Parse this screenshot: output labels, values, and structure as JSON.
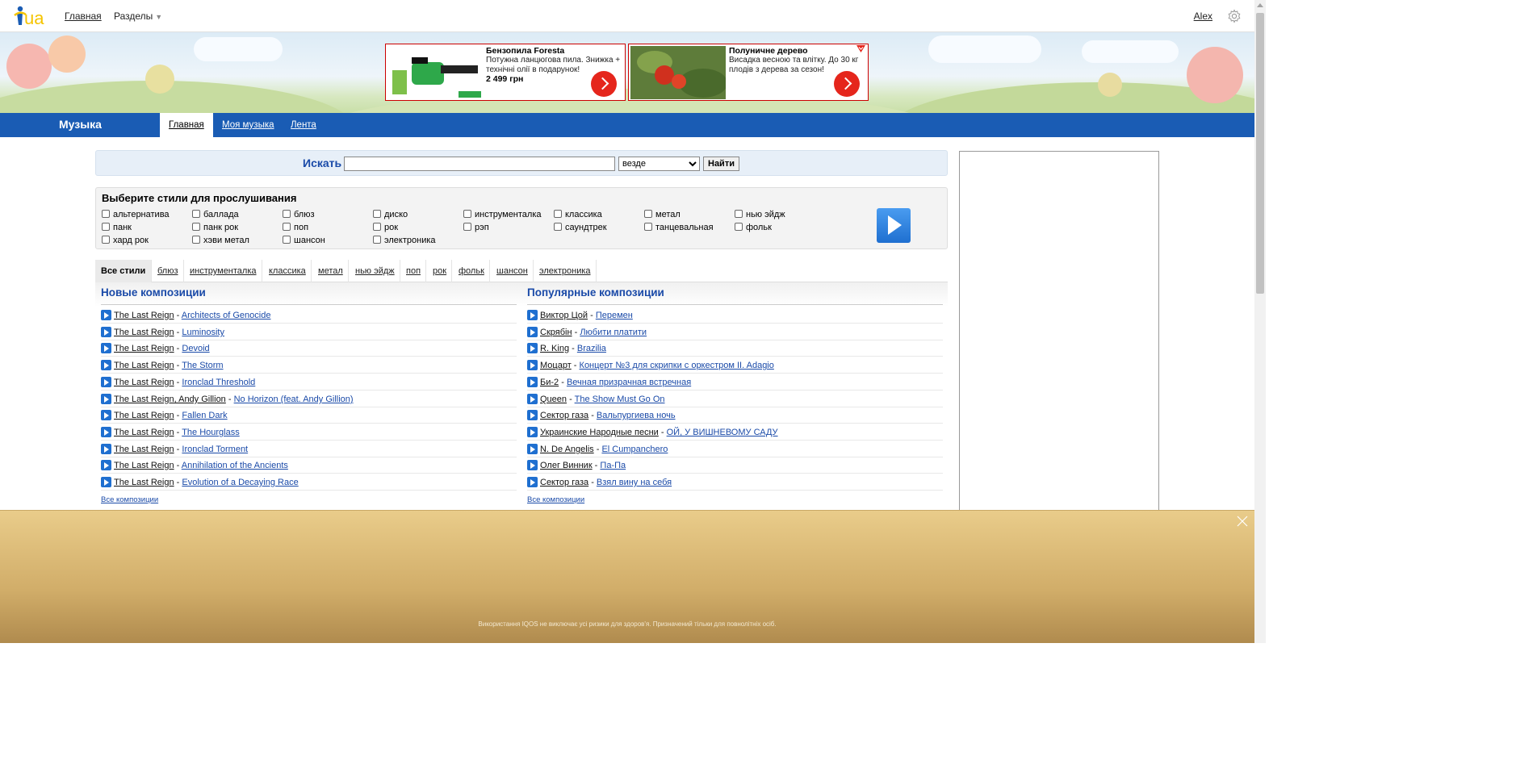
{
  "topbar": {
    "logo": "i.ua",
    "home_link": "Главная",
    "sections_menu": "Разделы",
    "user_name": "Alex"
  },
  "ads": [
    {
      "title": "Бензопила Foresta",
      "desc": "Потужна ланцюгова пила. Знижка + технічні олії в подарунок!",
      "price": "2 499 грн"
    },
    {
      "title": "Полуничне дерево",
      "desc": "Висадка весною та влітку. До 30 кг плодів з дерева за сезон!",
      "price": ""
    }
  ],
  "nav": {
    "section_title": "Музыка",
    "tabs": [
      "Главная",
      "Моя музыка",
      "Лента"
    ]
  },
  "search": {
    "label": "Искать",
    "query": "",
    "scope": "везде",
    "submit": "Найти"
  },
  "styles": {
    "heading": "Выберите стили для прослушивания",
    "rows": [
      [
        "альтернатива",
        "баллада",
        "блюз",
        "диско",
        "инструменталка",
        "классика",
        "метал",
        "нью эйдж"
      ],
      [
        "панк",
        "панк рок",
        "поп",
        "рок",
        "рэп",
        "саундтрек",
        "танцевальная",
        "фольк"
      ],
      [
        "хард рок",
        "хэви метал",
        "шансон",
        "электроника"
      ]
    ]
  },
  "filter_tabs": [
    "Все стили",
    "блюз",
    "инструменталка",
    "классика",
    "метал",
    "нью эйдж",
    "поп",
    "рок",
    "фольк",
    "шансон",
    "электроника"
  ],
  "new_tracks": {
    "heading": "Новые композиции",
    "all_link": "Все композиции",
    "items": [
      {
        "artist": "The Last Reign",
        "title": "Architects of Genocide"
      },
      {
        "artist": "The Last Reign",
        "title": "Luminosity"
      },
      {
        "artist": "The Last Reign",
        "title": "Devoid"
      },
      {
        "artist": "The Last Reign",
        "title": "The Storm"
      },
      {
        "artist": "The Last Reign",
        "title": "Ironclad Threshold"
      },
      {
        "artist": "The Last Reign, Andy Gillion",
        "title": "No Horizon (feat. Andy Gillion)"
      },
      {
        "artist": "The Last Reign",
        "title": "Fallen Dark"
      },
      {
        "artist": "The Last Reign",
        "title": "The Hourglass"
      },
      {
        "artist": "The Last Reign",
        "title": "Ironclad Torment"
      },
      {
        "artist": "The Last Reign",
        "title": "Annihilation of the Ancients"
      },
      {
        "artist": "The Last Reign",
        "title": "Evolution of a Decaying Race"
      }
    ]
  },
  "popular_tracks": {
    "heading": "Популярные композиции",
    "all_link": "Все композиции",
    "items": [
      {
        "artist": "Виктор Цой",
        "title": "Перемен"
      },
      {
        "artist": "Скрябін",
        "title": "Любити платити"
      },
      {
        "artist": "R. King",
        "title": "Brazilia"
      },
      {
        "artist": "Моцарт",
        "title": "Концерт №3 для скрипки с оркестром II. Adagio"
      },
      {
        "artist": "Би-2",
        "title": "Вечная призрачная встречная"
      },
      {
        "artist": "Queen",
        "title": "The Show Must Go On"
      },
      {
        "artist": "Сектор газа",
        "title": "Вальпургиева ночь"
      },
      {
        "artist": "Украинские Народные песни",
        "title": "ОЙ, У ВИШНЕВОМУ САДУ"
      },
      {
        "artist": "N. De Angelis",
        "title": "El Cumpanchero"
      },
      {
        "artist": "Олег Винник",
        "title": "Па-Па"
      },
      {
        "artist": "Сектор газа",
        "title": "Взял вину на себя"
      }
    ]
  },
  "bottom_ad": {
    "disclaimer": "Використання IQOS не виключає усі ризики для здоров'я. Призначений тільки для повнолітніх осіб."
  },
  "colors": {
    "brand_blue": "#1a5cb4",
    "link_blue": "#1a4aa8",
    "ad_red": "#e5261c"
  }
}
